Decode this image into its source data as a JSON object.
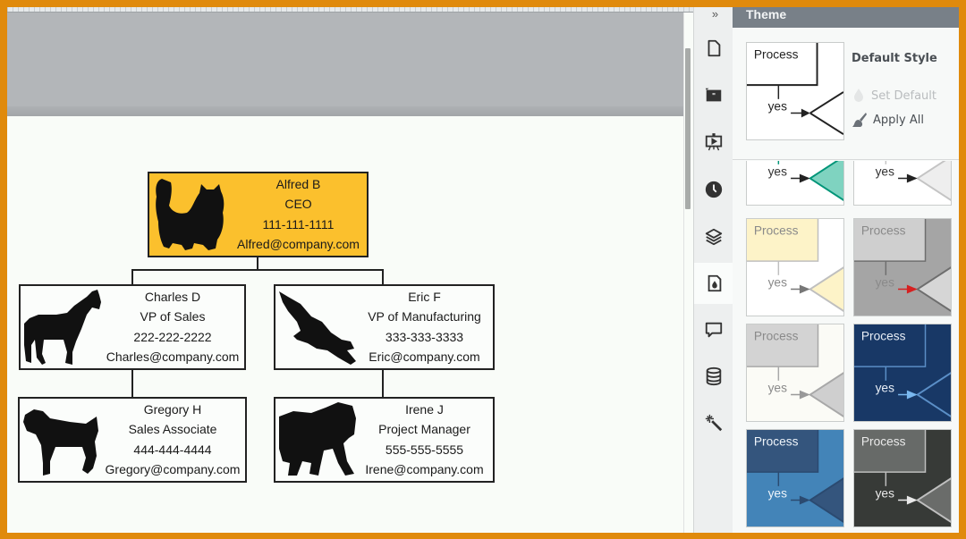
{
  "canvas": {
    "org_chart": {
      "ceo": {
        "name": "Alfred B",
        "title": "CEO",
        "phone": "111-111-1111",
        "email": "Alfred@company.com",
        "animal_icon": "cat-silhouette-icon",
        "fill": "#fbc02d"
      },
      "level2": [
        {
          "name": "Charles D",
          "title": "VP of Sales",
          "phone": "222-222-2222",
          "email": "Charles@company.com",
          "animal_icon": "horse-silhouette-icon"
        },
        {
          "name": "Eric F",
          "title": "VP of Manufacturing",
          "phone": "333-333-3333",
          "email": "Eric@company.com",
          "animal_icon": "eagle-silhouette-icon"
        }
      ],
      "level3": [
        {
          "name": "Gregory H",
          "title": "Sales Associate",
          "phone": "444-444-4444",
          "email": "Gregory@company.com",
          "animal_icon": "dog-silhouette-icon"
        },
        {
          "name": "Irene J",
          "title": "Project Manager",
          "phone": "555-555-5555",
          "email": "Irene@company.com",
          "animal_icon": "elephant-silhouette-icon"
        }
      ]
    }
  },
  "sidebar": {
    "collapse_label": "»",
    "icons": [
      {
        "name": "page-icon",
        "active": false
      },
      {
        "name": "quote-icon",
        "active": false
      },
      {
        "name": "presentation-icon",
        "active": false
      },
      {
        "name": "history-clock-icon",
        "active": false
      },
      {
        "name": "layers-icon",
        "active": false
      },
      {
        "name": "theme-icon",
        "active": true
      },
      {
        "name": "comment-icon",
        "active": false
      },
      {
        "name": "database-icon",
        "active": false
      },
      {
        "name": "magic-wand-icon",
        "active": false
      }
    ]
  },
  "theme_panel": {
    "header": "Theme",
    "default_style": {
      "title": "Default Style",
      "set_default_label": "Set Default",
      "apply_all_label": "Apply All"
    },
    "preview_labels": {
      "process": "Process",
      "yes": "yes"
    },
    "themes": [
      {
        "name": "teal",
        "bg": "#ffffff",
        "box": "#ffffff",
        "text": "#333333",
        "line": "#009578",
        "fill": "#7fd3c0",
        "arrow": "#222222"
      },
      {
        "name": "light-grey",
        "bg": "#ffffff",
        "box": "#ffffff",
        "text": "#333333",
        "line": "#c4c4c4",
        "fill": "#eeeeee",
        "arrow": "#222222"
      },
      {
        "name": "cream",
        "bg": "#ffffff",
        "box": "#fdf3c8",
        "text": "#8a8a8a",
        "line": "#bfbfbf",
        "fill": "#fdf3c8",
        "arrow": "#777777"
      },
      {
        "name": "grey-red",
        "bg": "#a5a5a5",
        "box": "#cfcfcf",
        "text": "#8a8a8a",
        "line": "#6e6e6e",
        "fill": "#d6d6d6",
        "arrow": "#d62020"
      },
      {
        "name": "ivory-grey",
        "bg": "#fbfbf6",
        "box": "#d3d3d3",
        "text": "#8a8a8a",
        "line": "#a8a8a8",
        "fill": "#cfcfcf",
        "arrow": "#999999"
      },
      {
        "name": "navy",
        "bg": "#183866",
        "box": "#183866",
        "text": "#e8eef6",
        "line": "#5b8fc7",
        "fill": "#183866",
        "arrow": "#7ab8ef"
      },
      {
        "name": "steel-blue",
        "bg": "#4384b8",
        "box": "#34557d",
        "text": "#eef4fa",
        "line": "#2b4a70",
        "fill": "#34557d",
        "arrow": "#2b4a70"
      },
      {
        "name": "charcoal",
        "bg": "#373a37",
        "box": "#676a68",
        "text": "#e9e9e9",
        "line": "#bfbfbf",
        "fill": "#6a6c6a",
        "arrow": "#e9e9e9"
      }
    ]
  }
}
